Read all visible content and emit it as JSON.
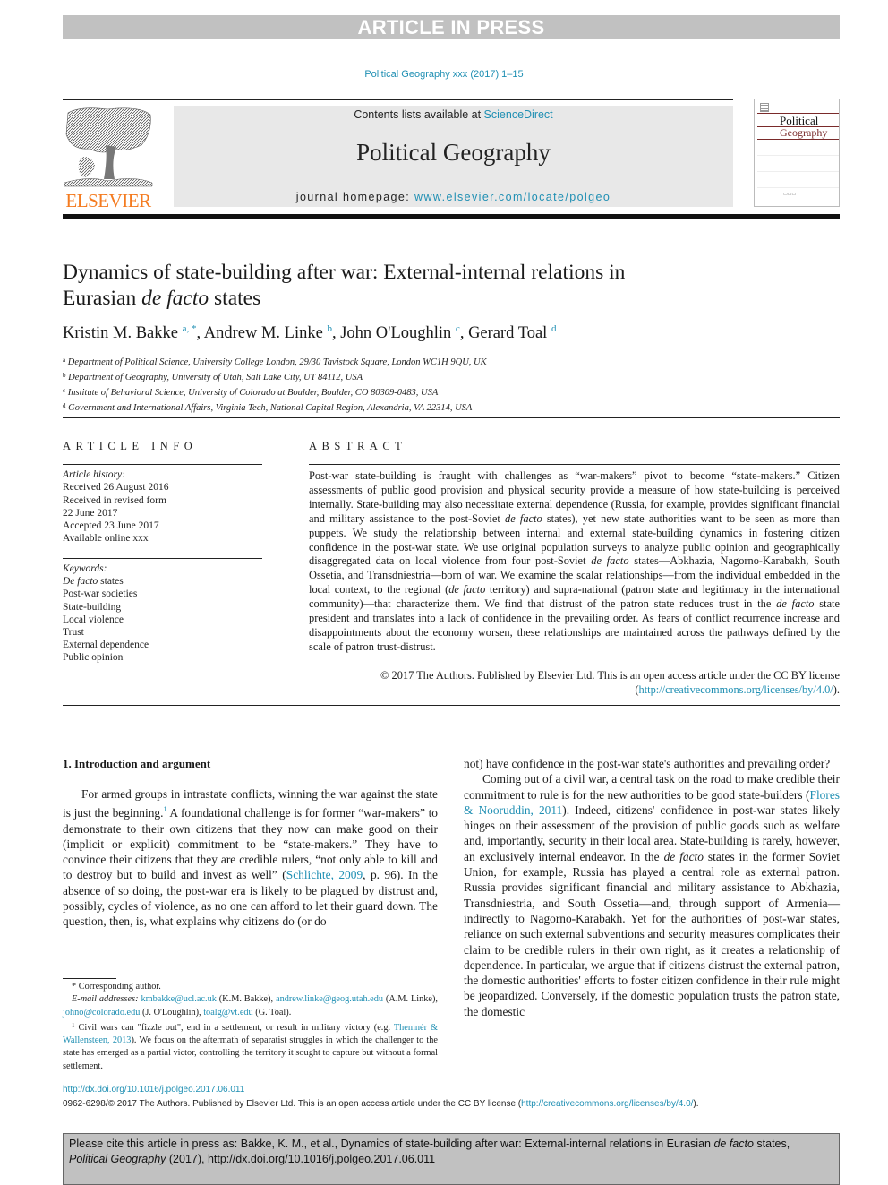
{
  "banner": {
    "text": "ARTICLE IN PRESS"
  },
  "journal_citation": "Political Geography xxx (2017) 1–15",
  "masthead": {
    "publisher_logo_word": "ELSEVIER",
    "contents_prefix": "Contents lists available at ",
    "contents_link": "ScienceDirect",
    "journal_title": "Political Geography",
    "homepage_prefix": "journal homepage: ",
    "homepage_link": "www.elsevier.com/locate/polgeo",
    "cover": {
      "title_line1": "Political",
      "title_line2": "Geography"
    }
  },
  "article": {
    "title_part1": "Dynamics of state-building after war: External-internal relations in",
    "title_part2_prefix": "Eurasian ",
    "title_part2_italic": "de facto",
    "title_part2_suffix": " states",
    "authors": [
      {
        "name": "Kristin M. Bakke",
        "sup": "a, *",
        "sep": ", "
      },
      {
        "name": "Andrew M. Linke",
        "sup": "b",
        "sep": ", "
      },
      {
        "name": "John O'Loughlin",
        "sup": "c",
        "sep": ", "
      },
      {
        "name": "Gerard Toal",
        "sup": "d",
        "sep": ""
      }
    ],
    "affiliations": [
      {
        "key": "a",
        "text": "Department of Political Science, University College London, 29/30 Tavistock Square, London WC1H 9QU, UK"
      },
      {
        "key": "b",
        "text": "Department of Geography, University of Utah, Salt Lake City, UT 84112, USA"
      },
      {
        "key": "c",
        "text": "Institute of Behavioral Science, University of Colorado at Boulder, Boulder, CO 80309-0483, USA"
      },
      {
        "key": "d",
        "text": "Government and International Affairs, Virginia Tech, National Capital Region, Alexandria, VA 22314, USA"
      }
    ]
  },
  "article_info": {
    "label": "ARTICLE INFO",
    "history_header": "Article history:",
    "history": [
      "Received 26 August 2016",
      "Received in revised form",
      "22 June 2017",
      "Accepted 23 June 2017",
      "Available online xxx"
    ],
    "keywords_header": "Keywords:",
    "keyword_first_italic": "De facto",
    "keyword_first_rest": " states",
    "keywords": [
      "Post-war societies",
      "State-building",
      "Local violence",
      "Trust",
      "External dependence",
      "Public opinion"
    ]
  },
  "abstract": {
    "label": "ABSTRACT",
    "t1": "Post-war state-building is fraught with challenges as “war-makers” pivot to become “state-makers.” Citizen assessments of public good provision and physical security provide a measure of how state-building is perceived internally. State-building may also necessitate external dependence (Russia, for example, provides significant financial and military assistance to the post-Soviet ",
    "i1": "de facto",
    "t2": " states), yet new state authorities want to be seen as more than puppets. We study the relationship between internal and external state-building dynamics in fostering citizen confidence in the post-war state. We use original population surveys to analyze public opinion and geographically disaggregated data on local violence from four post-Soviet ",
    "i2": "de facto",
    "t3": " states—Abkhazia, Nagorno-Karabakh, South Ossetia, and Transdniestria—born of war. We examine the scalar relationships—from the individual embedded in the local context, to the regional (",
    "i3": "de facto",
    "t4": " territory) and supra-national (patron state and legitimacy in the international community)—that characterize them. We find that distrust of the patron state reduces trust in the ",
    "i4": "de facto",
    "t5": " state president and translates into a lack of confidence in the prevailing order. As fears of conflict recurrence increase and disappointments about the economy worsen, these relationships are maintained across the pathways defined by the scale of patron trust-distrust.",
    "copyright": "© 2017 The Authors. Published by Elsevier Ltd. This is an open access article under the CC BY license",
    "license_open": "(",
    "license_link": "http://creativecommons.org/licenses/by/4.0/",
    "license_close": ")."
  },
  "body": {
    "section_heading": "1.  Introduction and argument",
    "left": {
      "p1_a": "For armed groups in intrastate conflicts, winning the war against the state is just the beginning.",
      "p1_fn": "1",
      "p1_b": " A foundational challenge is for former “war-makers” to demonstrate to their own citizens that they now can make good on their (implicit or explicit) commitment to be “state-makers.” They have to convince their citizens that they are credible rulers, “not only able to kill and to destroy but to build and invest as well” (",
      "p1_ref": "Schlichte, 2009",
      "p1_c": ", p. 96). In the absence of so doing, the post-war era is likely to be plagued by distrust and, possibly, cycles of violence, as no one can afford to let their guard down. The question, then, is, what explains why citizens do (or do"
    },
    "right": {
      "p0": "not) have confidence in the post-war state's authorities and prevailing order?",
      "p2_a": "Coming out of a civil war, a central task on the road to make credible their commitment to rule is for the new authorities to be good state-builders (",
      "p2_ref": "Flores & Nooruddin, 2011",
      "p2_b": "). Indeed, citizens' confidence in post-war states likely hinges on their assessment of the provision of public goods such as welfare and, importantly, security in their local area. State-building is rarely, however, an exclusively internal endeavor. In the ",
      "p2_i": "de facto",
      "p2_c": " states in the former Soviet Union, for example, Russia has played a central role as external patron. Russia provides significant financial and military assistance to Abkhazia, Transdniestria, and South Ossetia—and, through support of Armenia—indirectly to Nagorno-Karabakh. Yet for the authorities of post-war states, reliance on such external subventions and security measures complicates their claim to be credible rulers in their own right, as it creates a relationship of dependence. In particular, we argue that if citizens distrust the external patron, the domestic authorities' efforts to foster citizen confidence in their rule might be jeopardized. Conversely, if the domestic population trusts the patron state, the domestic"
    }
  },
  "footnotes": {
    "corresponding": "* Corresponding author.",
    "email_label": "E-mail addresses:",
    "emails": [
      {
        "addr": "kmbakke@ucl.ac.uk",
        "who": " (K.M. Bakke), "
      },
      {
        "addr": "andrew.linke@geog.utah.edu",
        "who": " (A.M. Linke), "
      },
      {
        "addr": "johno@colorado.edu",
        "who": " (J. O'Loughlin), "
      },
      {
        "addr": "toalg@vt.edu",
        "who": " (G. Toal)."
      }
    ],
    "fn1_num": "1",
    "fn1_a": " Civil wars can \"fizzle out\", end in a settlement, or result in military victory (e.g. ",
    "fn1_ref": "Themnér & Wallensteen, 2013",
    "fn1_b": "). We focus on the aftermath of separatist struggles in which the challenger to the state has emerged as a partial victor, controlling the territory it sought to capture but without a formal settlement."
  },
  "footer": {
    "doi": "http://dx.doi.org/10.1016/j.polgeo.2017.06.011",
    "issn_text": "0962-6298/© 2017 The Authors. Published by Elsevier Ltd. This is an open access article under the CC BY license (",
    "issn_link": "http://creativecommons.org/licenses/by/4.0/",
    "issn_close": ").",
    "cite_a": "Please cite this article in press as: Bakke, K. M., et al., Dynamics of state-building after war: External-internal relations in Eurasian ",
    "cite_i1": "de facto",
    "cite_b": " states,",
    "cite_i2": "Political Geography",
    "cite_c": " (2017), http://dx.doi.org/10.1016/j.polgeo.2017.06.011"
  }
}
